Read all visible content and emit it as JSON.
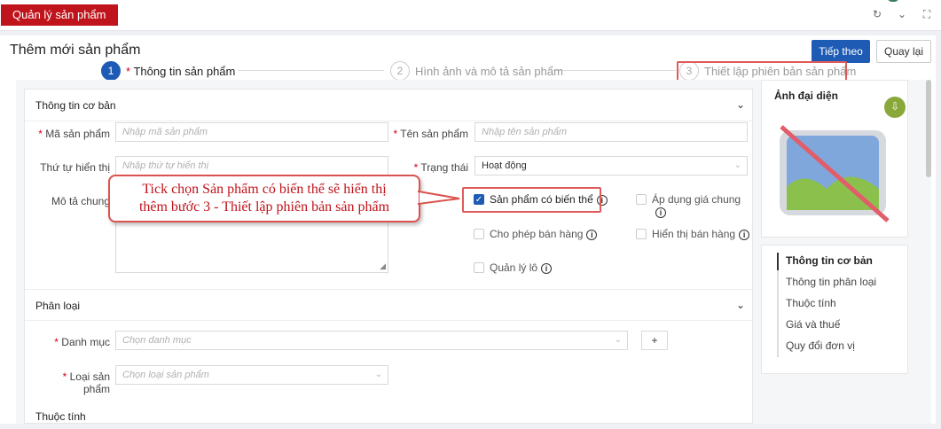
{
  "app_tab": "Quản lý sản phẩm",
  "page_title": "Thêm mới sản phẩm",
  "buttons": {
    "next": "Tiếp theo",
    "back": "Quay lại"
  },
  "steps": [
    {
      "num": "1",
      "label": "Thông tin sản phẩm",
      "required": "*"
    },
    {
      "num": "2",
      "label": "Hình ảnh và mô tả sản phẩm"
    },
    {
      "num": "3",
      "label": "Thiết lập phiên bản sản phẩm"
    }
  ],
  "basic_info": {
    "title": "Thông tin cơ bản",
    "code_label": "Mã sản phẩm",
    "code_placeholder": "Nhập mã sản phẩm",
    "name_label": "Tên sản phẩm",
    "name_placeholder": "Nhập tên sản phẩm",
    "order_label": "Thứ tự hiển thị",
    "order_placeholder": "Nhập thứ tự hiển thị",
    "status_label": "Trạng thái",
    "status_value": "Hoạt động",
    "desc_label": "Mô tả chung"
  },
  "checkboxes": {
    "variant": "Sản phẩm có biến thể",
    "common_price": "Áp dụng giá chung",
    "allow_sale": "Cho phép bán hàng",
    "show_sale": "Hiển thị bán hàng",
    "lot": "Quản lý lô"
  },
  "classification": {
    "title": "Phân loại",
    "category_label": "Danh mục",
    "category_placeholder": "Chọn danh mục",
    "add": "+",
    "type_label": "Loại sản phẩm",
    "type_placeholder": "Chọn loại sản phẩm",
    "next_section_peek": "Thuộc tính"
  },
  "avatar_panel": {
    "title": "Ảnh đại diện"
  },
  "side_nav": [
    "Thông tin cơ bản",
    "Thông tin phân loại",
    "Thuộc tính",
    "Giá và thuế",
    "Quy đổi đơn vị"
  ],
  "callout": {
    "line1": "Tick chọn Sản phẩm có biến thể sẽ hiển thị",
    "line2": "thêm bước 3 -  Thiết lập phiên bản sản phẩm"
  },
  "colors": {
    "brand_red": "#c0141c",
    "primary_blue": "#1e5bb5",
    "annotation_red": "#e05a5a"
  },
  "icons": {
    "refresh": "refresh-icon",
    "chevron": "chevron-down-icon",
    "maximize": "maximize-icon",
    "upload": "upload-icon",
    "info": "info-icon"
  }
}
